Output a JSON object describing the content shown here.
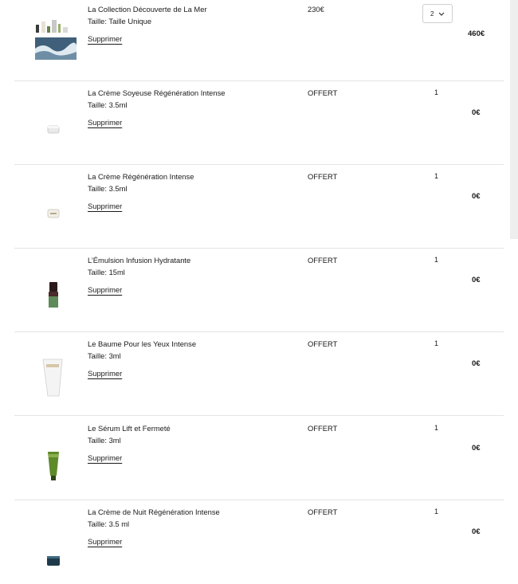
{
  "cart": {
    "remove_label": "Supprimer",
    "items": [
      {
        "name": "La Collection Découverte de La Mer",
        "size": "Taille: Taille Unique",
        "price": "230€",
        "quantity": "2",
        "total": "460€",
        "icon": "collection-thumbnail"
      },
      {
        "name": "La Crème Soyeuse Régénération Intense",
        "size": "Taille: 3.5ml",
        "price": "OFFERT",
        "quantity": "1",
        "total": "0€",
        "icon": "jar-thumbnail"
      },
      {
        "name": "La Crème Régénération Intense",
        "size": "Taille: 3.5ml",
        "price": "OFFERT",
        "quantity": "1",
        "total": "0€",
        "icon": "jar-thumbnail"
      },
      {
        "name": "L’Émulsion Infusion Hydratante",
        "size": "Taille: 15ml",
        "price": "OFFERT",
        "quantity": "1",
        "total": "0€",
        "icon": "bottle-thumbnail"
      },
      {
        "name": "Le Baume Pour les Yeux Intense",
        "size": "Taille: 3ml",
        "price": "OFFERT",
        "quantity": "1",
        "total": "0€",
        "icon": "tube-thumbnail"
      },
      {
        "name": "Le Sérum Lift et Fermeté",
        "size": "Taille: 3ml",
        "price": "OFFERT",
        "quantity": "1",
        "total": "0€",
        "icon": "green-tube-thumbnail"
      },
      {
        "name": "La Crème de Nuit Régénération Intense",
        "size": "Taille: 3.5 ml",
        "price": "OFFERT",
        "quantity": "1",
        "total": "0€",
        "icon": "night-jar-thumbnail"
      }
    ]
  }
}
